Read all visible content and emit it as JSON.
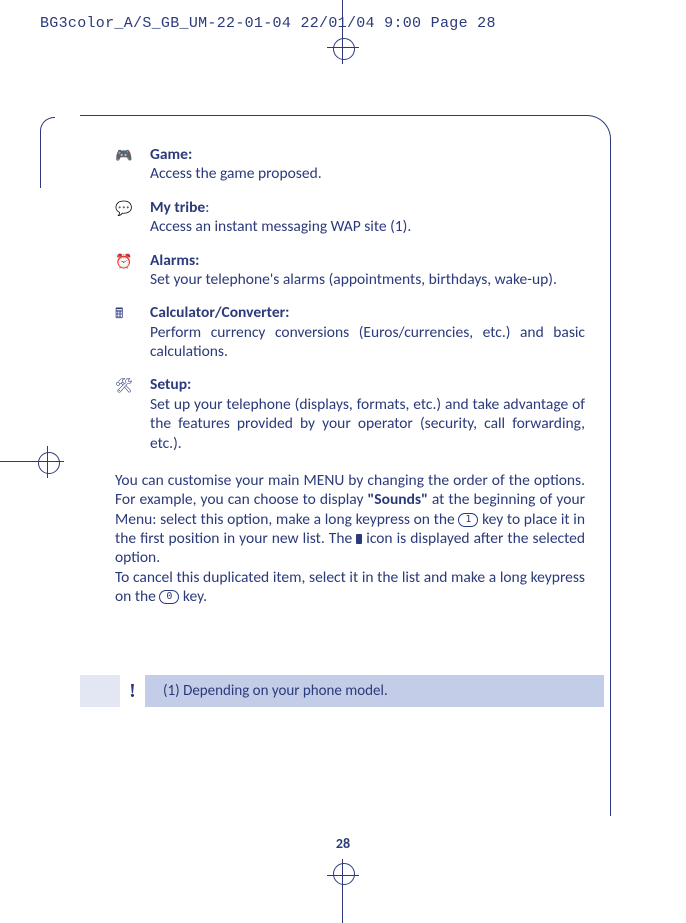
{
  "header": "BG3color_A/S_GB_UM-22-01-04  22/01/04  9:00  Page 28",
  "items": [
    {
      "icon": "🎮",
      "title": "Game:",
      "desc": "Access the game proposed."
    },
    {
      "icon": "💬",
      "title": "My tribe",
      "title_suffix": ":",
      "desc": "Access an instant messaging WAP site (1)."
    },
    {
      "icon": "⏰",
      "title": "Alarms:",
      "desc": "Set your telephone's alarms (appointments, birthdays, wake-up)."
    },
    {
      "icon": "🖩",
      "title": "Calculator/Converter:",
      "desc": "Perform currency conversions (Euros/currencies, etc.) and basic calculations."
    },
    {
      "icon": "🛠",
      "title": "Setup:",
      "desc": "Set up your telephone (displays, formats, etc.) and take advantage of the features provided by your operator (security, call forwarding, etc.)."
    }
  ],
  "para": {
    "p1a": "You can customise your main MENU by changing the order of the options. For example, you can choose to display ",
    "p1b_bold": "\"Sounds\"",
    "p1c": " at the beginning of your Menu: select this option, make a long keypress on the ",
    "key1": "1",
    "p1d": " key to place it in the first position in your new list. The ",
    "p1e": " icon is displayed after the selected option.",
    "p2a": "To cancel this duplicated item, select it in the list and make a long keypress on the ",
    "key2": "0",
    "p2b": " key."
  },
  "footnote": "(1)  Depending on your phone model.",
  "page_number": "28"
}
